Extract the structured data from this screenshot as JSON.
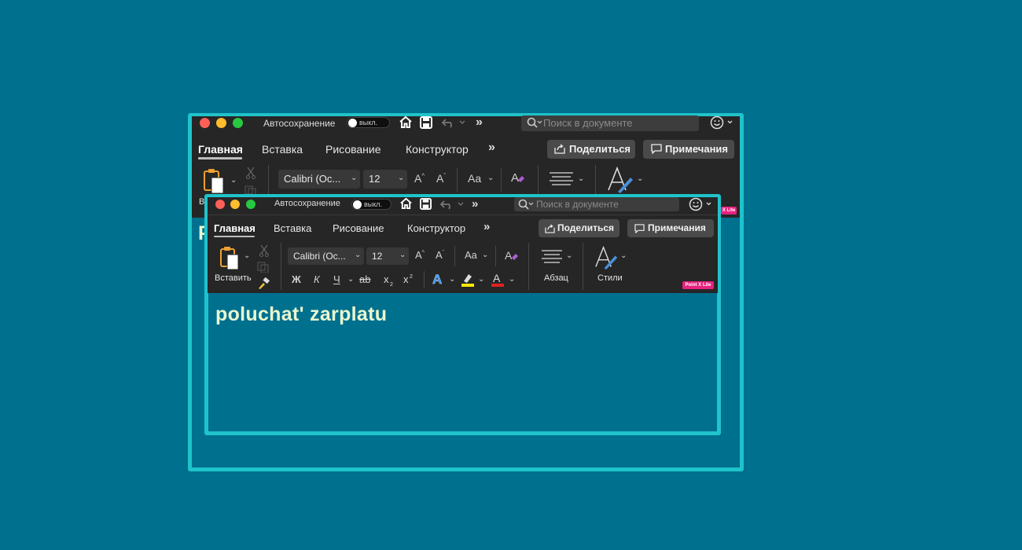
{
  "colors": {
    "background": "#00708f",
    "frame": "#1fc3cb",
    "titlebar": "#262626",
    "doc_text": "#e9f7cf",
    "badge": "#e6217f"
  },
  "titlebar": {
    "autosave_label": "Автосохранение",
    "autosave_state": "выкл.",
    "search_placeholder": "Поиск в документе"
  },
  "tabs": [
    "Главная",
    "Вставка",
    "Рисование",
    "Конструктор"
  ],
  "more_tabs_glyph": "»",
  "buttons": {
    "share": "Поделиться",
    "comments": "Примечания"
  },
  "ribbon": {
    "paste_label": "Вставить",
    "font_name": "Calibri (Ос...",
    "font_size": "12",
    "format_bold": "Ж",
    "format_italic": "К",
    "format_underline": "Ч",
    "format_strike": "ab",
    "change_case": "Aa",
    "paragraph_label": "Абзац",
    "styles_label": "Стили",
    "back_paste_fragment": "В"
  },
  "badge": "Point X Lite",
  "back_badge": "X Lite",
  "document": {
    "text": "poluchat'  zarplatu",
    "back_fragment": "P"
  },
  "icons": [
    "home-icon",
    "save-icon",
    "undo-icon",
    "more-icon",
    "search-icon",
    "smiley-icon",
    "clipboard-icon",
    "scissors-icon",
    "copy-icon",
    "format-painter-icon",
    "clear-format-icon",
    "align-icon",
    "styles-pen-icon",
    "share-icon",
    "comment-icon"
  ]
}
